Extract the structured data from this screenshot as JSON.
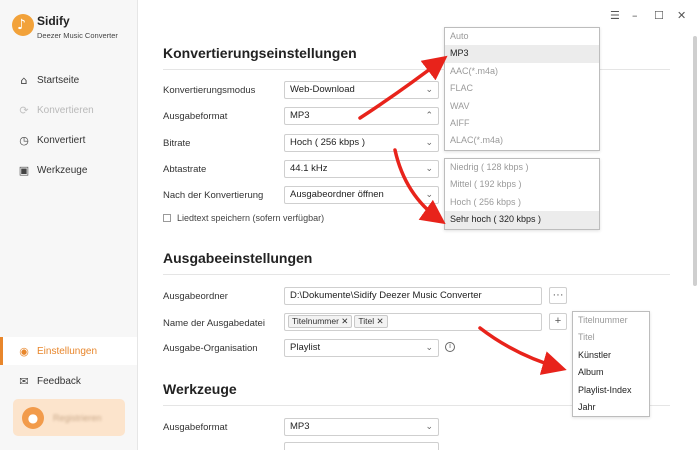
{
  "app": {
    "name": "Sidify",
    "subtitle": "Deezer Music Converter",
    "logo_icon": "music-note-icon"
  },
  "window_controls": {
    "menu": "☰",
    "minimize": "–",
    "maximize": "☐",
    "close": "✕"
  },
  "sidebar": {
    "items": [
      {
        "label": "Startseite",
        "icon": "home-icon",
        "state": "normal"
      },
      {
        "label": "Konvertieren",
        "icon": "convert-icon",
        "state": "disabled"
      },
      {
        "label": "Konvertiert",
        "icon": "clock-icon",
        "state": "normal"
      },
      {
        "label": "Werkzeuge",
        "icon": "toolbox-icon",
        "state": "normal"
      },
      {
        "label": "Einstellungen",
        "icon": "settings-icon",
        "state": "active"
      },
      {
        "label": "Feedback",
        "icon": "mail-icon",
        "state": "normal"
      }
    ],
    "register_label": "Registrieren"
  },
  "conversion": {
    "title": "Konvertierungseinstellungen",
    "mode_label": "Konvertierungsmodus",
    "mode_value": "Web-Download",
    "format_label": "Ausgabeformat",
    "format_value": "MP3",
    "bitrate_label": "Bitrate",
    "bitrate_value": "Hoch ( 256 kbps )",
    "samplerate_label": "Abtastrate",
    "samplerate_value": "44.1 kHz",
    "after_label": "Nach der Konvertierung",
    "after_value": "Ausgabeordner öffnen",
    "lyrics_label": "Liedtext speichern (sofern verfügbar)"
  },
  "format_dropdown": {
    "options": [
      "Auto",
      "MP3",
      "AAC(*.m4a)",
      "FLAC",
      "WAV",
      "AIFF",
      "ALAC(*.m4a)"
    ],
    "selected": "MP3"
  },
  "bitrate_dropdown": {
    "options": [
      "Niedrig ( 128 kbps )",
      "Mittel ( 192 kbps )",
      "Hoch ( 256 kbps )",
      "Sehr hoch ( 320 kbps )"
    ],
    "selected": "Sehr hoch ( 320 kbps )"
  },
  "output": {
    "title": "Ausgabeeinstellungen",
    "folder_label": "Ausgabeordner",
    "folder_value": "D:\\Dokumente\\Sidify Deezer Music Converter",
    "folder_button": "···",
    "filename_label": "Name der Ausgabedatei",
    "filename_tags": [
      "Titelnummer ✕",
      "Titel ✕"
    ],
    "add_button": "+",
    "organization_label": "Ausgabe-Organisation",
    "organization_value": "Playlist"
  },
  "naming_dropdown": {
    "options": [
      "Titelnummer",
      "Titel",
      "Künstler",
      "Album",
      "Playlist-Index",
      "Jahr"
    ],
    "disabled": [
      "Titelnummer",
      "Titel"
    ]
  },
  "tools": {
    "title": "Werkzeuge",
    "format_label": "Ausgabeformat",
    "format_value": "MP3"
  },
  "colors": {
    "accent": "#e8862b",
    "arrow": "#e8231b",
    "sidebar_bg": "#f7f7f7"
  }
}
